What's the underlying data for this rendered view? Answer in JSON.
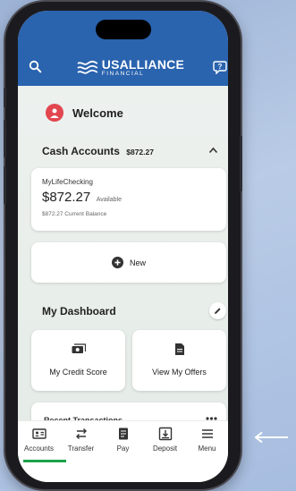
{
  "header": {
    "logo_main": "USALLIANCE",
    "logo_sub": "FINANCIAL"
  },
  "welcome": {
    "text": "Welcome"
  },
  "cash_accounts": {
    "title": "Cash Accounts",
    "total": "$872.27",
    "account": {
      "name": "MyLifeChecking",
      "balance": "$872.27",
      "available_label": "Available",
      "current_text": "$872.27 Current Balance"
    },
    "new_label": "New"
  },
  "dashboard": {
    "title": "My Dashboard",
    "tiles": [
      {
        "label": "My Credit Score"
      },
      {
        "label": "View My Offers"
      }
    ],
    "recent_label": "Recent Transactions"
  },
  "tabs": [
    {
      "label": "Accounts",
      "active": true
    },
    {
      "label": "Transfer"
    },
    {
      "label": "Pay"
    },
    {
      "label": "Deposit"
    },
    {
      "label": "Menu"
    }
  ],
  "colors": {
    "header": "#2a63ae",
    "active_tab": "#1aa34a",
    "avatar": "#e2474f"
  }
}
